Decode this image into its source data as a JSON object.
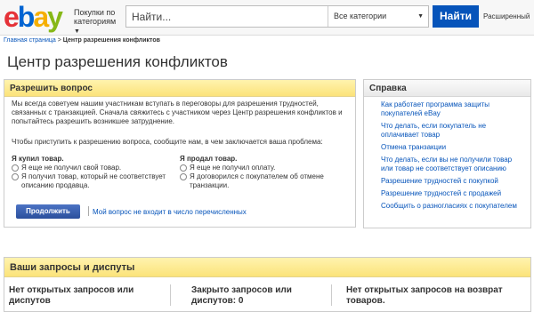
{
  "header": {
    "logo": {
      "e": "e",
      "b": "b",
      "a": "a",
      "y": "y"
    },
    "category_menu": "Покупки по категориям",
    "search_placeholder": "Найти...",
    "category_select": "Все категории",
    "search_button": "Найти",
    "advanced_link": "Расширенный"
  },
  "breadcrumb": {
    "home": "Главная страница",
    "separator": ">",
    "current": "Центр разрешения конфликтов"
  },
  "page_title": "Центр разрешения конфликтов",
  "resolve": {
    "heading": "Разрешить вопрос",
    "intro": "Мы всегда советуем нашим участникам вступать в переговоры для разрешения трудностей, связанных с транзакцией. Сначала свяжитесь с участником через Центр разрешения конфликтов и попытайтесь разрешить возникшее затруднение.",
    "prompt": "Чтобы приступить к разрешению вопроса, сообщите нам, в чем заключается ваша проблема:",
    "bought": {
      "title": "Я купил товар.",
      "options": [
        "Я еще не получил свой товар.",
        "Я получил товар, который не соответствует описанию продавца."
      ]
    },
    "sold": {
      "title": "Я продал товар.",
      "options": [
        "Я еще не получил оплату.",
        "Я договорился с покупателем об отмене транзакции."
      ]
    },
    "continue_button": "Продолжить",
    "not_listed_link": "Мой вопрос не входит в число перечисленных"
  },
  "help": {
    "heading": "Справка",
    "items": [
      "Как работает программа защиты покупателей eBay",
      "Что делать, если покупатель не оплачивает товар",
      "Отмена транзакции",
      "Что делать, если вы не получили товар или товар не соответствует описанию",
      "Разрешение трудностей с покупкой",
      "Разрешение трудностей с продажей",
      "Сообщить о разногласиях с покупателем"
    ]
  },
  "requests": {
    "heading": "Ваши запросы и диспуты",
    "columns": [
      "Нет открытых запросов или диспутов",
      "Закрыто запросов или диспутов: 0",
      "Нет открытых запросов на возврат товаров."
    ]
  }
}
